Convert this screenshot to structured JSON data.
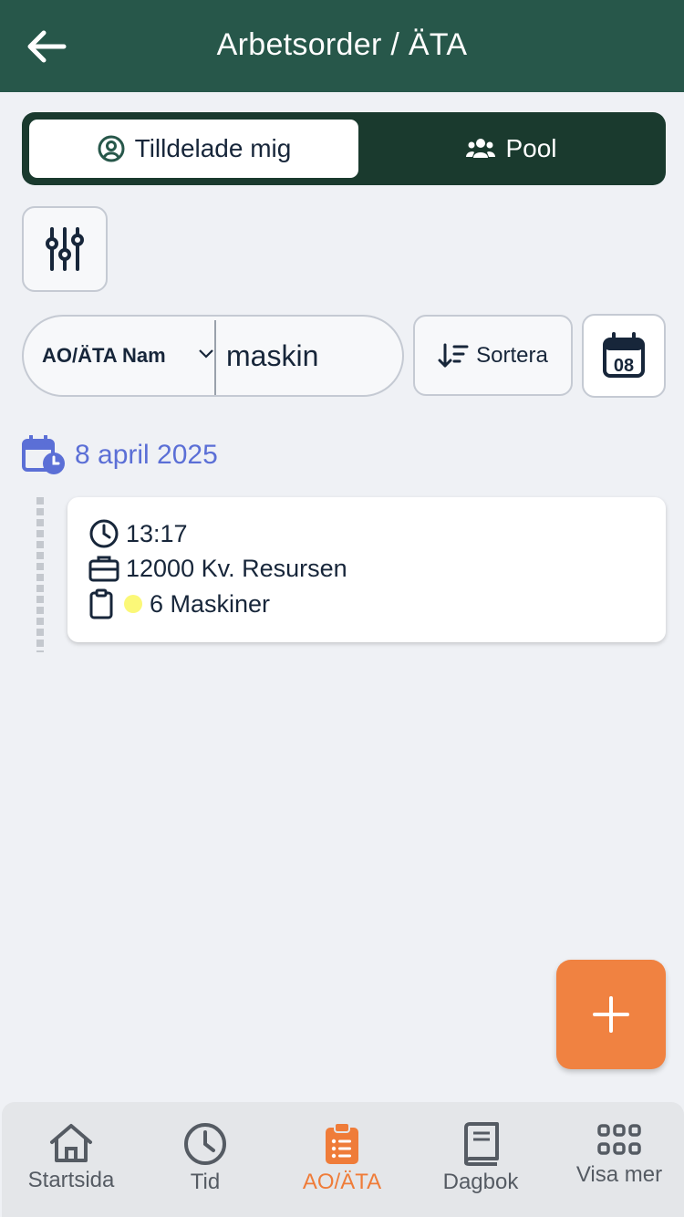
{
  "header": {
    "title": "Arbetsorder / ÄTA"
  },
  "segments": {
    "assigned": "Tilldelade mig",
    "pool": "Pool"
  },
  "search": {
    "field": "AO/ÄTA Nam",
    "query": "maskin"
  },
  "sort": {
    "label": "Sortera"
  },
  "calendar": {
    "day": "08"
  },
  "group": {
    "date": "8 april 2025"
  },
  "item": {
    "time": "13:17",
    "project": "12000 Kv. Resursen",
    "title": "6 Maskiner",
    "status_color": "#fbf878"
  },
  "colors": {
    "header": "#27574a",
    "accent": "#f08241",
    "date": "#5b6fd6"
  },
  "tabs": [
    {
      "label": "Startsida",
      "icon": "home-icon"
    },
    {
      "label": "Tid",
      "icon": "clock-icon"
    },
    {
      "label": "AO/ÄTA",
      "icon": "clipboard-list-icon"
    },
    {
      "label": "Dagbok",
      "icon": "book-icon"
    },
    {
      "label": "Visa mer",
      "icon": "grid-icon"
    }
  ]
}
